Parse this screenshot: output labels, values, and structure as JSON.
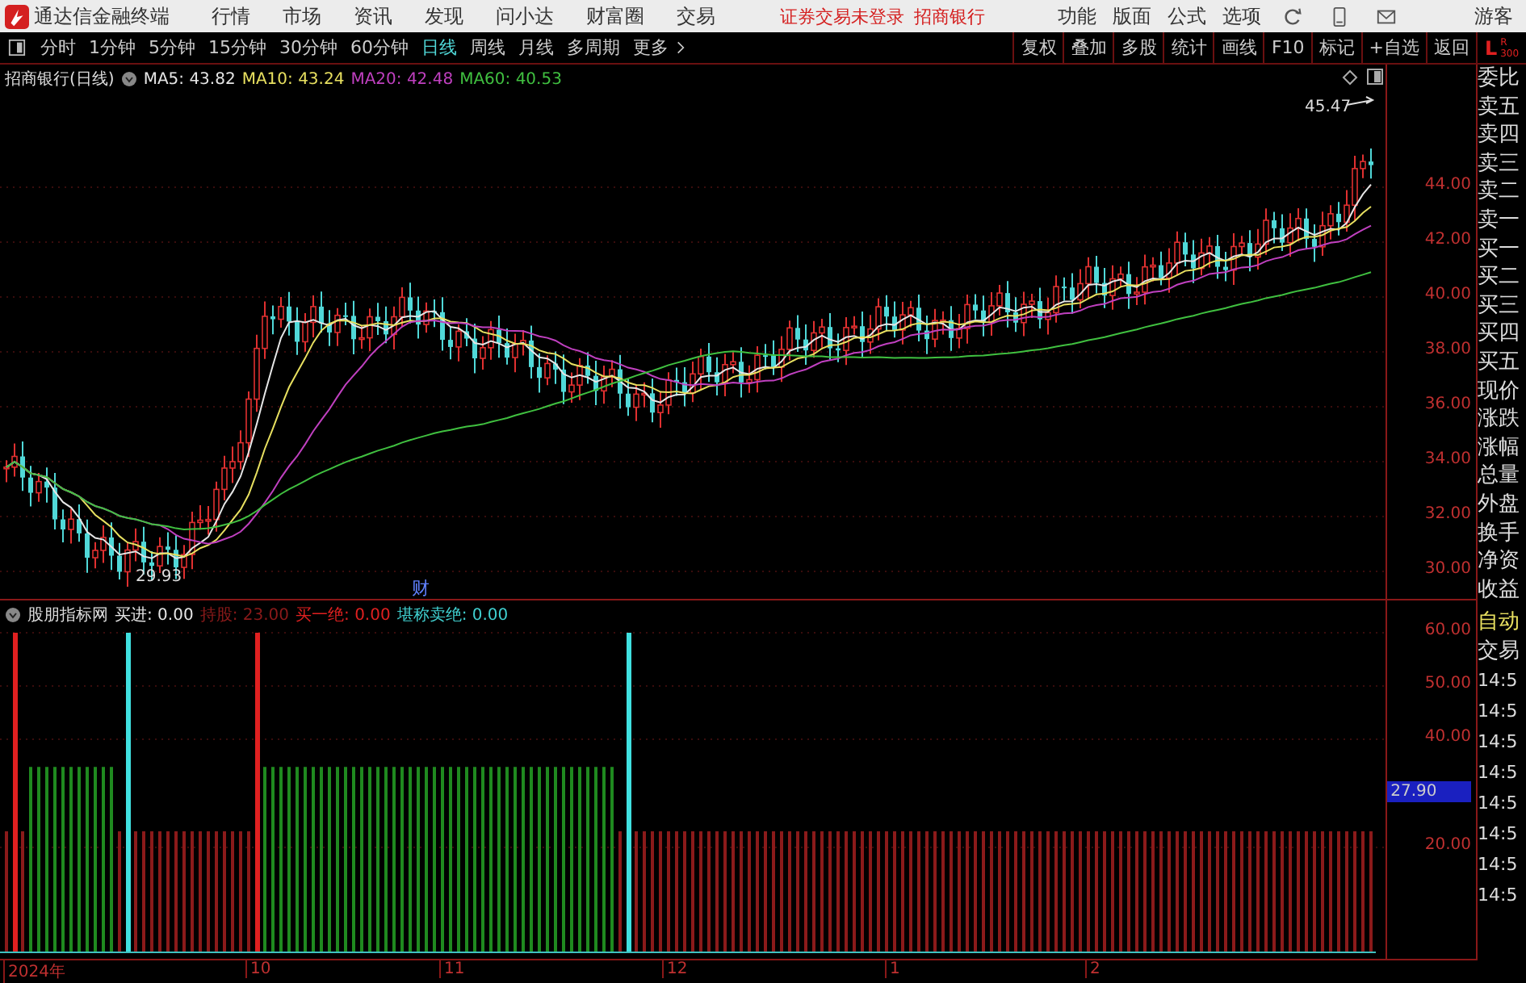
{
  "title_bar": {
    "app_name": "通达信金融终端",
    "menus": [
      "行情",
      "市场",
      "资讯",
      "发现",
      "问小达",
      "财富圈",
      "交易"
    ],
    "login_status": "证券交易未登录",
    "broker": "招商银行",
    "tools": [
      "功能",
      "版面",
      "公式",
      "选项"
    ],
    "user": "游客"
  },
  "toolbar": {
    "periods": [
      {
        "label": "分时",
        "selected": false
      },
      {
        "label": "1分钟",
        "selected": false
      },
      {
        "label": "5分钟",
        "selected": false
      },
      {
        "label": "15分钟",
        "selected": false
      },
      {
        "label": "30分钟",
        "selected": false
      },
      {
        "label": "60分钟",
        "selected": false
      },
      {
        "label": "日线",
        "selected": true
      },
      {
        "label": "周线",
        "selected": false
      },
      {
        "label": "月线",
        "selected": false
      },
      {
        "label": "多周期",
        "selected": false
      },
      {
        "label": "更多",
        "selected": false
      }
    ],
    "actions": [
      "复权",
      "叠加",
      "多股",
      "统计",
      "画线",
      "F10",
      "标记",
      "+自选",
      "返回"
    ],
    "l_label": "L",
    "r_label": "R",
    "r_sub": "300"
  },
  "price_chart": {
    "title": "招商银行(日线)",
    "ma": [
      {
        "label": "MA5: 43.82",
        "color": "#e6e6e6"
      },
      {
        "label": "MA10: 43.24",
        "color": "#e8e060"
      },
      {
        "label": "MA20: 42.48",
        "color": "#c040c0"
      },
      {
        "label": "MA60: 40.53",
        "color": "#40c040"
      }
    ],
    "high_label": "45.47",
    "low_label": "29.93",
    "marker": "财",
    "yticks": [
      "44.00",
      "42.00",
      "40.00",
      "38.00",
      "36.00",
      "34.00",
      "32.00",
      "30.00"
    ]
  },
  "indicator": {
    "name": "股朋指标网",
    "values": [
      {
        "label": "买进: 0.00",
        "color": "#e6e6e6"
      },
      {
        "label": "持股: 23.00",
        "color": "#8b1a1a"
      },
      {
        "label": "买一绝: 0.00",
        "color": "#e02020"
      },
      {
        "label": "堪称卖绝: 0.00",
        "color": "#40d0d0"
      }
    ],
    "yticks": [
      "60.00",
      "50.00",
      "40.00",
      "20.00"
    ],
    "cursor_value": "27.90"
  },
  "x_axis": [
    "2024年",
    "10",
    "11",
    "12",
    "1",
    "2"
  ],
  "quote_panel": {
    "labels": [
      "委比",
      "卖五",
      "卖四",
      "卖三",
      "卖二",
      "卖一",
      "买一",
      "买二",
      "买三",
      "买四",
      "买五",
      "现价",
      "涨跌",
      "涨幅",
      "总量",
      "外盘",
      "换手",
      "净资",
      "收益"
    ],
    "auto_label": "自动",
    "trade_label": "交易",
    "times": [
      "14:5",
      "14:5",
      "14:5",
      "14:5",
      "14:5",
      "14:5",
      "14:5",
      "14:5"
    ]
  }
}
